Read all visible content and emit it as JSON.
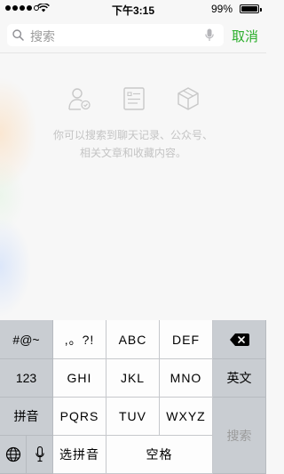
{
  "status_bar": {
    "time": "下午3:15",
    "battery_percent": "99%",
    "battery_level": 0.99,
    "signal_dots_filled": 4,
    "signal_dots_total": 5
  },
  "search": {
    "placeholder": "搜索",
    "cancel_label": "取消"
  },
  "suggestions": {
    "icons": [
      "contact-icon",
      "article-icon",
      "cube-icon"
    ],
    "hint_line1": "你可以搜索到聊天记录、公众号、",
    "hint_line2": "相关文章和收藏内容。"
  },
  "keyboard": {
    "left_column": [
      "#@~",
      "123",
      "拼音"
    ],
    "row1": [
      ",。?!",
      "ABC",
      "DEF"
    ],
    "row2": [
      "GHI",
      "JKL",
      "MNO"
    ],
    "row3": [
      "PQRS",
      "TUV",
      "WXYZ"
    ],
    "right_column": [
      "英文",
      "搜索"
    ],
    "bottom": {
      "pinyin_select": "选拼音",
      "space": "空格"
    },
    "icons": {
      "delete": "backspace-icon",
      "globe": "globe-icon",
      "mic": "microphone-icon"
    }
  },
  "colors": {
    "accent": "#2aae2a",
    "hint_text": "#c4c4c4",
    "keyboard_bg": "#c9cdd2"
  }
}
